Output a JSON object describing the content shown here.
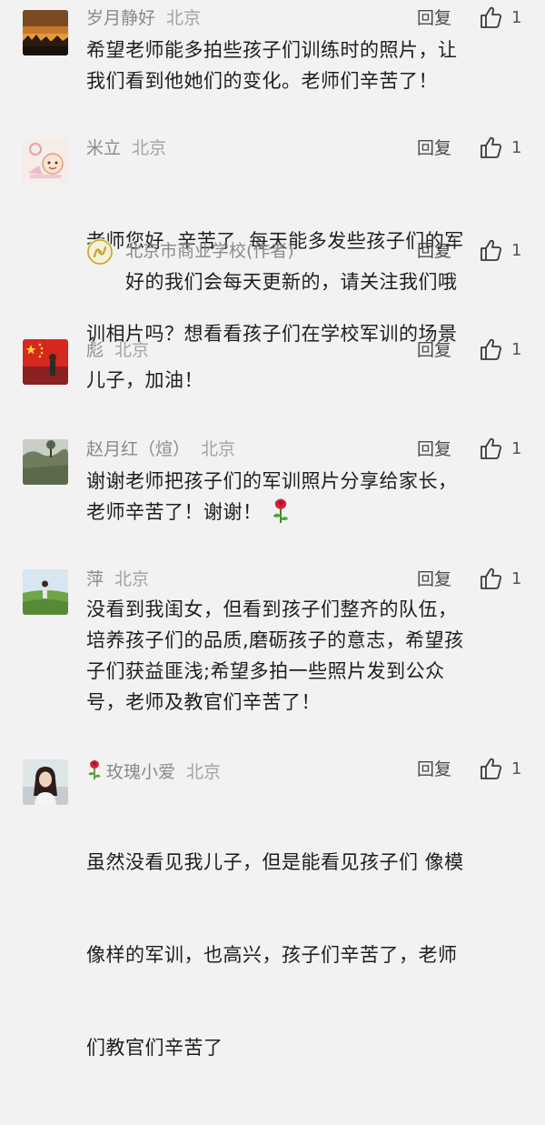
{
  "reply_label": "回复",
  "comments": [
    {
      "name": "岁月静好",
      "location": "北京",
      "likes": "1",
      "avatar_icon": "sunset-avatar-icon",
      "lines": [
        "希望老师能多拍些孩子们训练时的照片，让",
        "我们看到他她们的变化。老师们辛苦了！"
      ]
    },
    {
      "name": "米立",
      "location": "北京",
      "likes": "1",
      "avatar_icon": "cartoon-avatar-icon",
      "lines": [
        "老师您好  辛苦了  每天能多发些孩子们的军",
        "训相片吗？想看看孩子们在学校军训的场景"
      ],
      "reply": {
        "name": "北京市商业学校(作者)",
        "likes": "1",
        "avatar_icon": "school-logo-icon",
        "text": "好的我们会每天更新的，请关注我们哦"
      }
    },
    {
      "name": "彪",
      "location": "北京",
      "likes": "1",
      "avatar_icon": "flag-avatar-icon",
      "lines": [
        "儿子，加油！"
      ]
    },
    {
      "name": "赵月红（煊）",
      "location": "北京",
      "likes": "1",
      "avatar_icon": "landscape-avatar-icon",
      "lines": [
        "谢谢老师把孩子们的军训照片分享给家长，",
        "老师辛苦了！谢谢！"
      ],
      "emoji": "rose-emoji-icon"
    },
    {
      "name": "萍",
      "location": "北京",
      "likes": "1",
      "avatar_icon": "field-avatar-icon",
      "lines": [
        "没看到我闺女，但看到孩子们整齐的队伍，",
        "培养孩子们的品质,磨砺孩子的意志，希望孩",
        "子们获益匪浅;希望多拍一些照片发到公众",
        "号，老师及教官们辛苦了！"
      ]
    },
    {
      "name": "玫瑰小爱",
      "location": "北京",
      "likes": "1",
      "avatar_icon": "portrait-avatar-icon",
      "name_emoji": "rose-emoji-icon",
      "lines": [
        "虽然没看见我儿子，但是能看见孩子们 像模",
        "像样的军训，也高兴，孩子们辛苦了，老师",
        "们教官们辛苦了"
      ]
    }
  ]
}
